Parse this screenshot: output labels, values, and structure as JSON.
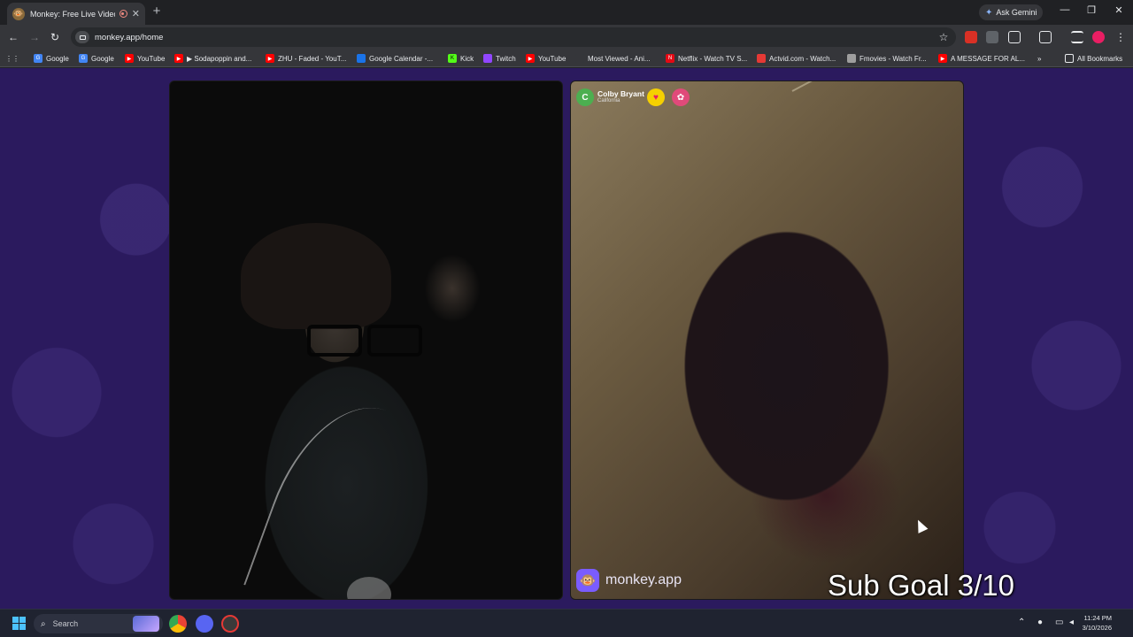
{
  "browser": {
    "tab": {
      "title": "Monkey: Free Live Video Ch",
      "favicon": "monkey-favicon"
    },
    "gemini_label": "Ask Gemini",
    "url": "monkey.app/home",
    "bookmarks": [
      {
        "label": "Google",
        "icon": "google-icon",
        "color": "#4285f4"
      },
      {
        "label": "Google",
        "icon": "google-icon",
        "color": "#4285f4"
      },
      {
        "label": "YouTube",
        "icon": "youtube-icon",
        "color": "#ff0000"
      },
      {
        "label": "▶ Sodapoppin and...",
        "icon": "youtube-icon",
        "color": "#ff0000"
      },
      {
        "label": "ZHU - Faded - YouT...",
        "icon": "youtube-icon",
        "color": "#ff0000"
      },
      {
        "label": "Google Calendar -...",
        "icon": "calendar-icon",
        "color": "#1a73e8"
      },
      {
        "label": "Kick",
        "icon": "kick-icon",
        "color": "#53fc18"
      },
      {
        "label": "Twitch",
        "icon": "twitch-icon",
        "color": "#9146ff"
      },
      {
        "label": "YouTube",
        "icon": "youtube-icon",
        "color": "#ff0000"
      },
      {
        "label": "Most Viewed - Ani...",
        "icon": "anime-icon",
        "color": "#35363a"
      },
      {
        "label": "Netflix - Watch TV S...",
        "icon": "netflix-icon",
        "color": "#e50914"
      },
      {
        "label": "Actvid.com - Watch...",
        "icon": "actvid-icon",
        "color": "#e53935"
      },
      {
        "label": "Fmovies - Watch Fr...",
        "icon": "fmovies-icon",
        "color": "#9e9e9e"
      },
      {
        "label": "A MESSAGE FOR AL...",
        "icon": "youtube-icon",
        "color": "#ff0000"
      }
    ],
    "all_bookmarks_label": "All Bookmarks"
  },
  "chat": {
    "partner": {
      "initial": "C",
      "name": "Colby Bryant",
      "location": "California"
    },
    "brand": "monkey.app",
    "overlay_text": "Sub Goal 3/10"
  },
  "taskbar": {
    "search_placeholder": "Search",
    "time": "11:24 PM",
    "date": "3/10/2026"
  },
  "colors": {
    "page_bg": "#2b1a5e",
    "accent": "#7a5cff"
  }
}
